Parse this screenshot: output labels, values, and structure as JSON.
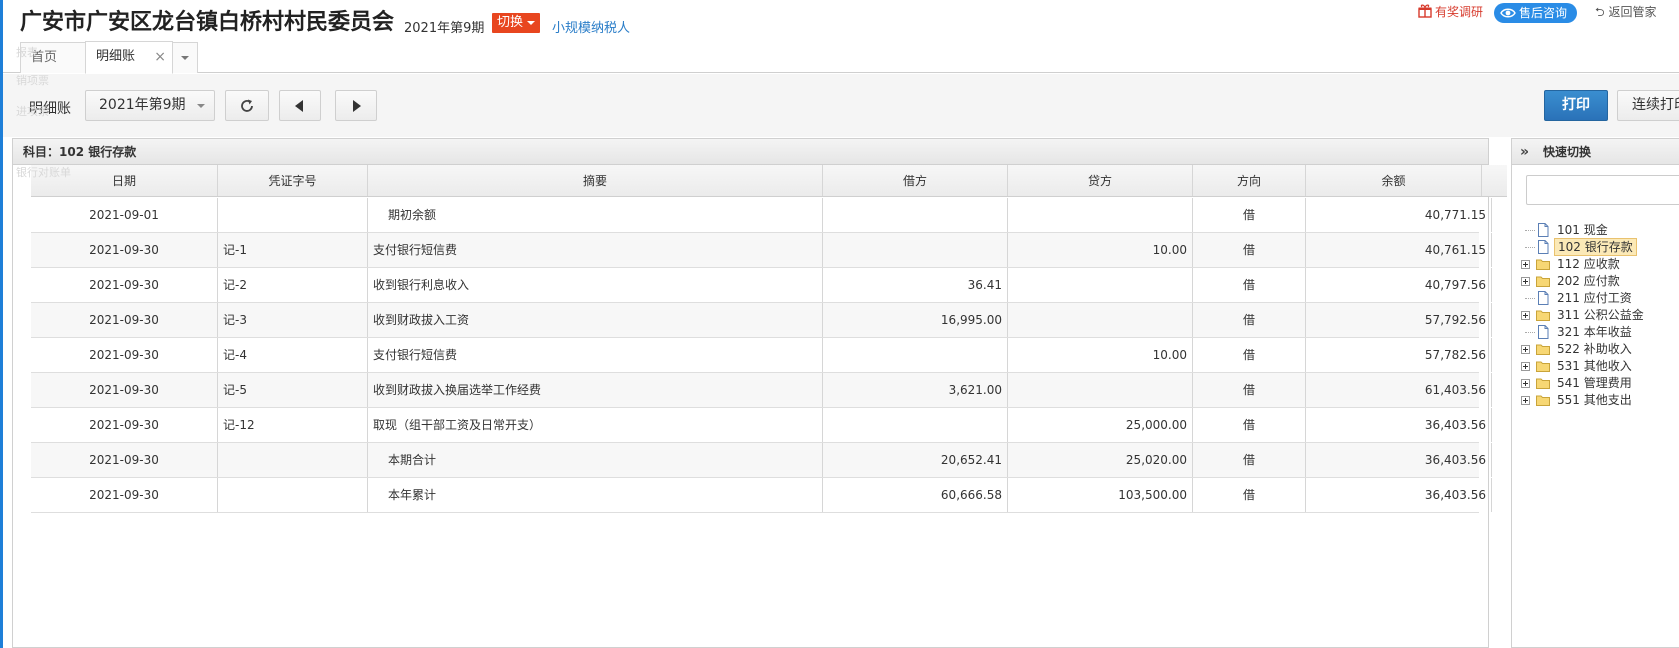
{
  "header": {
    "company": "广安市广安区龙台镇白桥村村民委员会",
    "period": "2021年第9期",
    "switch_label": "切换",
    "taxpayer": "小规模纳税人",
    "survey_label": "有奖调研",
    "aftersale_label": "售后咨询",
    "back_label": "返回管家"
  },
  "tabs": {
    "home": "首页",
    "active": "明细账",
    "close": "×"
  },
  "ghost_sidebar": [
    "报表",
    "销项票",
    "进项票",
    "银行对账单"
  ],
  "toolbar": {
    "label": "明细账",
    "period_value": "2021年第9期",
    "print_label": "打印",
    "continuous_print_label": "连续打印"
  },
  "ledger": {
    "subject": "科目：102  银行存款",
    "columns": [
      "日期",
      "凭证字号",
      "摘要",
      "借方",
      "贷方",
      "方向",
      "余额"
    ],
    "rows": [
      {
        "date": "2021-09-01",
        "voucher": "",
        "summary": "期初余额",
        "debit": "",
        "credit": "",
        "dir": "借",
        "balance": "40,771.15",
        "indent": true
      },
      {
        "date": "2021-09-30",
        "voucher": "记-1",
        "summary": "支付银行短信费",
        "debit": "",
        "credit": "10.00",
        "dir": "借",
        "balance": "40,761.15",
        "indent": false
      },
      {
        "date": "2021-09-30",
        "voucher": "记-2",
        "summary": "收到银行利息收入",
        "debit": "36.41",
        "credit": "",
        "dir": "借",
        "balance": "40,797.56",
        "indent": false
      },
      {
        "date": "2021-09-30",
        "voucher": "记-3",
        "summary": "收到财政拔入工资",
        "debit": "16,995.00",
        "credit": "",
        "dir": "借",
        "balance": "57,792.56",
        "indent": false
      },
      {
        "date": "2021-09-30",
        "voucher": "记-4",
        "summary": "支付银行短信费",
        "debit": "",
        "credit": "10.00",
        "dir": "借",
        "balance": "57,782.56",
        "indent": false
      },
      {
        "date": "2021-09-30",
        "voucher": "记-5",
        "summary": "收到财政拔入换届选举工作经费",
        "debit": "3,621.00",
        "credit": "",
        "dir": "借",
        "balance": "61,403.56",
        "indent": false
      },
      {
        "date": "2021-09-30",
        "voucher": "记-12",
        "summary": "取现（组干部工资及日常开支）",
        "debit": "",
        "credit": "25,000.00",
        "dir": "借",
        "balance": "36,403.56",
        "indent": false
      },
      {
        "date": "2021-09-30",
        "voucher": "",
        "summary": "本期合计",
        "debit": "20,652.41",
        "credit": "25,020.00",
        "dir": "借",
        "balance": "36,403.56",
        "indent": true
      },
      {
        "date": "2021-09-30",
        "voucher": "",
        "summary": "本年累计",
        "debit": "60,666.58",
        "credit": "103,500.00",
        "dir": "借",
        "balance": "36,403.56",
        "indent": true
      }
    ]
  },
  "quick_switch": {
    "collapse_glyph": "»",
    "title": "快速切换",
    "search_value": "",
    "items": [
      {
        "label": "101 现金",
        "type": "file",
        "expandable": false,
        "selected": false
      },
      {
        "label": "102 银行存款",
        "type": "file",
        "expandable": false,
        "selected": true
      },
      {
        "label": "112 应收款",
        "type": "folder",
        "expandable": true,
        "selected": false
      },
      {
        "label": "202 应付款",
        "type": "folder",
        "expandable": true,
        "selected": false
      },
      {
        "label": "211 应付工资",
        "type": "file",
        "expandable": false,
        "selected": false
      },
      {
        "label": "311 公积公益金",
        "type": "folder",
        "expandable": true,
        "selected": false
      },
      {
        "label": "321 本年收益",
        "type": "file",
        "expandable": false,
        "selected": false
      },
      {
        "label": "522 补助收入",
        "type": "folder",
        "expandable": true,
        "selected": false
      },
      {
        "label": "531 其他收入",
        "type": "folder",
        "expandable": true,
        "selected": false
      },
      {
        "label": "541 管理费用",
        "type": "folder",
        "expandable": true,
        "selected": false
      },
      {
        "label": "551 其他支出",
        "type": "folder",
        "expandable": true,
        "selected": false
      }
    ]
  },
  "colors": {
    "accent": "#2a8ce6",
    "switch": "#e8461f",
    "survey": "#d73a2c",
    "print": "#2a72b8",
    "selected_bg": "#fbe9b7"
  },
  "icons": [
    "gift-icon",
    "eye-icon",
    "back-arrow-icon",
    "refresh-icon",
    "prev-icon",
    "next-icon",
    "file-icon",
    "folder-icon",
    "expander-icon"
  ]
}
